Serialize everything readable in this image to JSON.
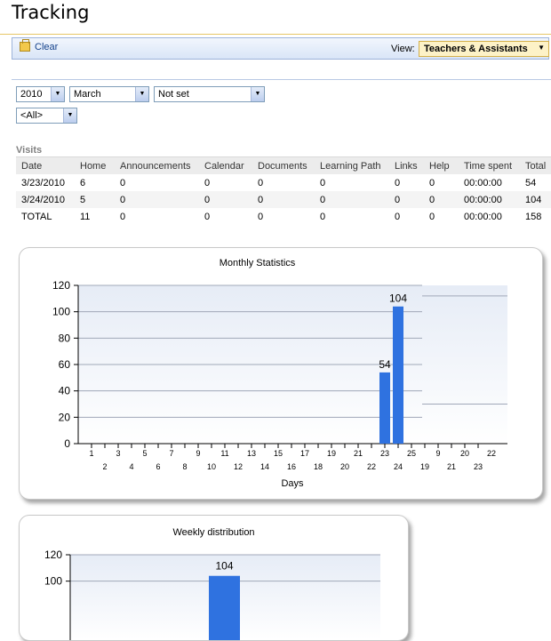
{
  "page": {
    "title": "Tracking"
  },
  "toolbar": {
    "clear_label": "Clear",
    "view_label": "View:",
    "view_value": "Teachers & Assistants"
  },
  "filters": {
    "year": "2010",
    "month": "March",
    "group": "Not set",
    "scope": "<All>"
  },
  "visits": {
    "label": "Visits",
    "columns": [
      "Date",
      "Home",
      "Announcements",
      "Calendar",
      "Documents",
      "Learning Path",
      "Links",
      "Help",
      "Time spent",
      "Total"
    ],
    "rows": [
      [
        "3/23/2010",
        "6",
        "0",
        "0",
        "0",
        "0",
        "0",
        "0",
        "00:00:00",
        "54"
      ],
      [
        "3/24/2010",
        "5",
        "0",
        "0",
        "0",
        "0",
        "0",
        "0",
        "00:00:00",
        "104"
      ],
      [
        "TOTAL",
        "11",
        "0",
        "0",
        "0",
        "0",
        "0",
        "0",
        "00:00:00",
        "158"
      ]
    ]
  },
  "chart_data": [
    {
      "type": "bar",
      "title": "Monthly Statistics",
      "xlabel": "Days",
      "ylabel": "",
      "ylim": [
        0,
        120
      ],
      "yticks": [
        0,
        20,
        40,
        60,
        80,
        100,
        120
      ],
      "x_labels_row1": [
        "1",
        "3",
        "5",
        "7",
        "9",
        "11",
        "13",
        "15",
        "17",
        "19",
        "21",
        "23",
        "25",
        "9",
        "20",
        "22"
      ],
      "x_labels_row2": [
        "2",
        "4",
        "6",
        "8",
        "10",
        "12",
        "14",
        "16",
        "18",
        "20",
        "22",
        "24",
        "19",
        "21",
        "23"
      ],
      "categories": [
        "23",
        "24"
      ],
      "values": [
        54,
        104
      ],
      "data_labels": [
        "54",
        "104"
      ],
      "bar_color": "#2f72e0"
    },
    {
      "type": "bar",
      "title": "Weekly distribution",
      "ylim": [
        0,
        120
      ],
      "yticks_visible": [
        100,
        120
      ],
      "values": [
        104
      ],
      "data_labels": [
        "104"
      ],
      "bar_color": "#2f72e0"
    }
  ]
}
